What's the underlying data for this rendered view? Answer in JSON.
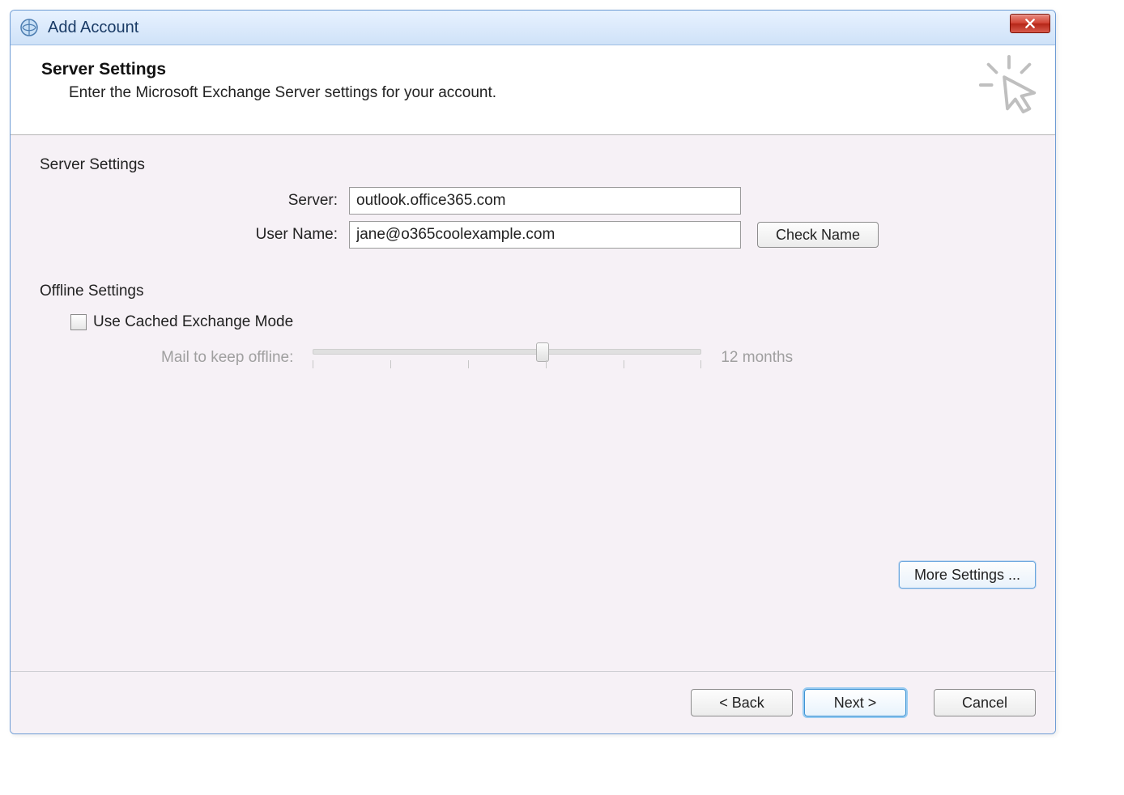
{
  "window": {
    "title": "Add Account"
  },
  "header": {
    "heading": "Server Settings",
    "subheading": "Enter the Microsoft Exchange Server settings for your account."
  },
  "serverSettings": {
    "group_label": "Server Settings",
    "server_label": "Server:",
    "server_value": "outlook.office365.com",
    "username_label": "User Name:",
    "username_value": "jane@o365coolexample.com",
    "check_name_label": "Check Name"
  },
  "offlineSettings": {
    "group_label": "Offline Settings",
    "cached_mode_label": "Use Cached Exchange Mode",
    "cached_mode_checked": false,
    "slider_label": "Mail to keep offline:",
    "slider_value_label": "12 months"
  },
  "footer": {
    "more_settings_label": "More Settings ...",
    "back_label": "< Back",
    "next_label": "Next >",
    "cancel_label": "Cancel"
  }
}
